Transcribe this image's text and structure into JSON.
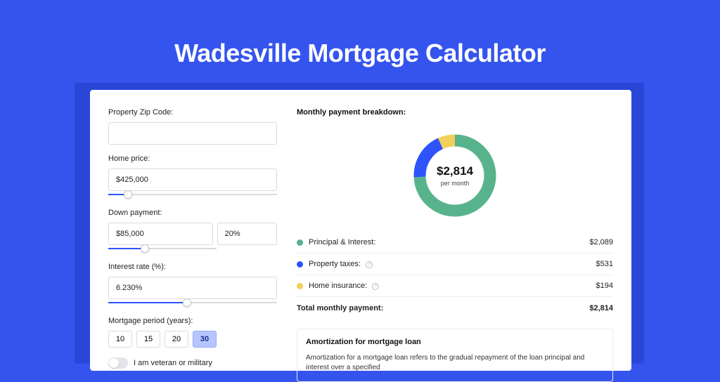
{
  "title": "Wadesville Mortgage Calculator",
  "form": {
    "zip": {
      "label": "Property Zip Code:",
      "value": ""
    },
    "home_price": {
      "label": "Home price:",
      "value": "$425,000",
      "slider_pct": 9
    },
    "down_payment": {
      "label": "Down payment:",
      "amount": "$85,000",
      "pct": "20%",
      "slider_pct": 30
    },
    "interest_rate": {
      "label": "Interest rate (%):",
      "value": "6.230%",
      "slider_pct": 44
    },
    "mortgage_period": {
      "label": "Mortgage period (years):",
      "options": [
        "10",
        "15",
        "20",
        "30"
      ],
      "selected": "30"
    },
    "veteran": {
      "label": "I am veteran or military",
      "on": false
    }
  },
  "breakdown": {
    "title": "Monthly payment breakdown:",
    "center_amount": "$2,814",
    "center_sub": "per month",
    "items": [
      {
        "label": "Principal & Interest:",
        "amount": "$2,089",
        "color": "#58b38d",
        "info": false
      },
      {
        "label": "Property taxes:",
        "amount": "$531",
        "color": "#2e53fa",
        "info": true
      },
      {
        "label": "Home insurance:",
        "amount": "$194",
        "color": "#f3cf5b",
        "info": true
      }
    ],
    "total_label": "Total monthly payment:",
    "total_amount": "$2,814"
  },
  "chart_data": {
    "type": "pie",
    "title": "Monthly payment breakdown",
    "categories": [
      "Principal & Interest",
      "Property taxes",
      "Home insurance"
    ],
    "values": [
      2089,
      531,
      194
    ],
    "colors": [
      "#58b38d",
      "#2e53fa",
      "#f3cf5b"
    ],
    "total": 2814
  },
  "amortization": {
    "title": "Amortization for mortgage loan",
    "text": "Amortization for a mortgage loan refers to the gradual repayment of the loan principal and interest over a specified"
  }
}
